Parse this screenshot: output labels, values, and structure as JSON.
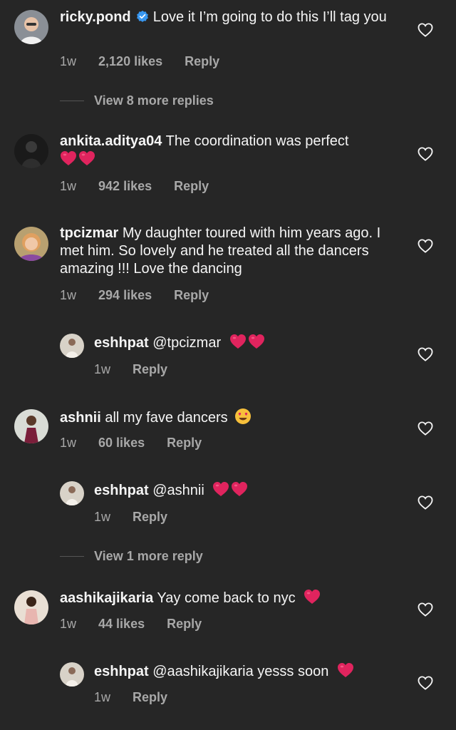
{
  "comments": [
    {
      "username": "ricky.pond",
      "verified": true,
      "text": "Love it I’m going to do this I’ll tag you",
      "time": "1w",
      "likes": "2,120 likes",
      "reply": "Reply",
      "avatar_icon": "man-avatar"
    },
    {
      "username": "ankita.aditya04",
      "text": "The coordination was perfect",
      "time": "1w",
      "likes": "942 likes",
      "reply": "Reply",
      "avatar_icon": "dark-silhouette-avatar"
    },
    {
      "username": "tpcizmar",
      "text": "My daughter toured with him years ago. I met him. So lovely and he treated all the dancers amazing !!! Love the dancing",
      "time": "1w",
      "likes": "294 likes",
      "reply": "Reply",
      "avatar_icon": "woman-avatar"
    },
    {
      "username": "ashnii",
      "text": "all my fave dancers",
      "time": "1w",
      "likes": "60 likes",
      "reply": "Reply",
      "avatar_icon": "woman-avatar"
    },
    {
      "username": "aashikajikaria",
      "text": "Yay come back to nyc",
      "time": "1w",
      "likes": "44 likes",
      "reply": "Reply",
      "avatar_icon": "woman-avatar"
    }
  ],
  "replies": [
    {
      "username": "eshhpat",
      "text": "@tpcizmar",
      "time": "1w",
      "reply": "Reply"
    },
    {
      "username": "eshhpat",
      "text": "@ashnii",
      "time": "1w",
      "reply": "Reply"
    },
    {
      "username": "eshhpat",
      "text": "@aashikajikaria yesss soon",
      "time": "1w",
      "reply": "Reply"
    }
  ],
  "view_more": [
    "View 8 more replies",
    "View 1 more reply"
  ],
  "colors": {
    "background": "#262626",
    "text": "#f5f5f5",
    "muted": "#a8a8a8",
    "verified": "#3897f0",
    "heart_emoji": "#e0245e"
  }
}
